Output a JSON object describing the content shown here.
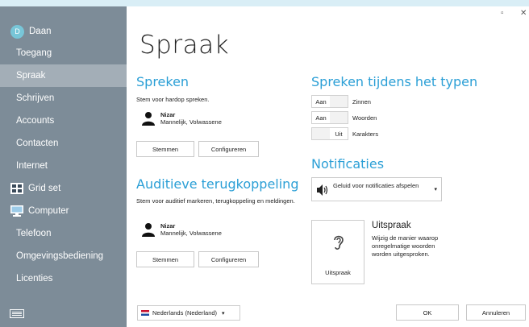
{
  "window": {
    "minimize_glyph": "▫",
    "close_glyph": "✕"
  },
  "sidebar": {
    "user": {
      "initial": "D",
      "name": "Daan"
    },
    "items": [
      {
        "label": "Toegang"
      },
      {
        "label": "Spraak",
        "active": true
      },
      {
        "label": "Schrijven"
      },
      {
        "label": "Accounts"
      },
      {
        "label": "Contacten"
      },
      {
        "label": "Internet"
      },
      {
        "label": "Grid set",
        "icon": "grid-icon"
      },
      {
        "label": "Computer",
        "icon": "computer-icon"
      },
      {
        "label": "Telefoon"
      },
      {
        "label": "Omgevingsbediening"
      },
      {
        "label": "Licenties"
      }
    ],
    "keyboard_icon": "keyboard-icon"
  },
  "main": {
    "title": "Spraak",
    "speaking": {
      "heading": "Spreken",
      "description": "Stem voor hardop spreken.",
      "voice_name": "Nizar",
      "voice_desc": "Mannelijk, Volwassene",
      "voices_button": "Stemmen",
      "configure_button": "Configureren"
    },
    "feedback": {
      "heading": "Auditieve terugkoppeling",
      "description": "Stem voor auditief markeren, terugkoppeling en meldingen.",
      "voice_name": "Nizar",
      "voice_desc": "Mannelijk, Volwassene",
      "voices_button": "Stemmen",
      "configure_button": "Configureren"
    },
    "typing": {
      "heading": "Spreken tijdens het typen",
      "rows": [
        {
          "on_label": "Aan",
          "off_label": "",
          "label": "Zinnen",
          "state": "on"
        },
        {
          "on_label": "Aan",
          "off_label": "",
          "label": "Woorden",
          "state": "on"
        },
        {
          "on_label": "",
          "off_label": "Uit",
          "label": "Karakters",
          "state": "off"
        }
      ]
    },
    "notifications": {
      "heading": "Notificaties",
      "dropdown_value": "Geluid voor notificaties afspelen"
    },
    "pronunciation": {
      "tile_label": "Uitspraak",
      "heading": "Uitspraak",
      "description": "Wijzig de manier waarop onregelmatige woorden worden uitgesproken."
    },
    "language": {
      "value": "Nederlands (Nederland)"
    },
    "ok_button": "OK",
    "cancel_button": "Annuleren"
  },
  "colors": {
    "sidebar_bg": "#7d8c98",
    "sidebar_active": "#a3aeb7",
    "accent": "#2b9fd6"
  }
}
